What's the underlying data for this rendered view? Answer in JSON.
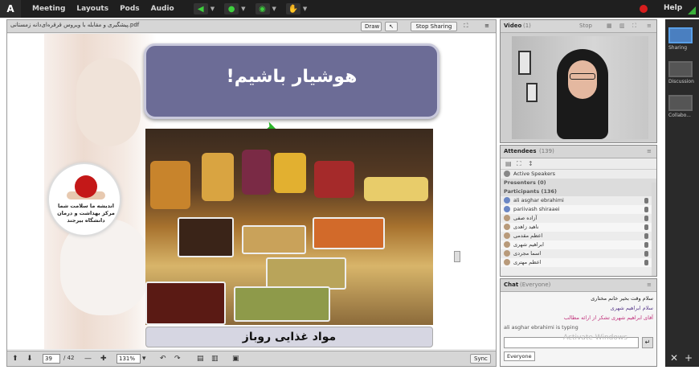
{
  "menubar": {
    "logo": "A",
    "items": [
      "Meeting",
      "Layouts",
      "Pods",
      "Audio"
    ],
    "help": "Help"
  },
  "share": {
    "filename": "پیشگیری و مقابله با ویروس قرقره‌ای‌دانه زمستانی.pdf",
    "draw_label": "Draw",
    "stop_label": "Stop Sharing",
    "menu_label": "≡"
  },
  "slide": {
    "title": "هوشیار باشیم!",
    "caption": "مواد غذایی روباز",
    "logo_text_1": "اندیشه ما سلامت شما",
    "logo_text_2": "مرکز بهداشت و درمان",
    "logo_text_3": "دانشگاه بیرجند"
  },
  "bottombar": {
    "page_value": "39",
    "page_total": "/ 42",
    "zoom_value": "131%",
    "sync_label": "Sync"
  },
  "video": {
    "title": "Video",
    "count": "(1)",
    "stop_label": "Stop"
  },
  "attendees": {
    "title": "Attendees",
    "count": "(139)",
    "active_speakers": "Active Speakers",
    "presenters": "Presenters (0)",
    "participants": "Participants (136)",
    "rows": [
      {
        "name": "ali asghar ebrahimi",
        "role": "host"
      },
      {
        "name": "pariivash shiraaei",
        "role": "host"
      },
      {
        "name": "آزاده صفی",
        "role": "participant"
      },
      {
        "name": "ناهید زاهدی",
        "role": "participant"
      },
      {
        "name": "اعظم مقدمی",
        "role": "participant"
      },
      {
        "name": "ابراهیم شهری",
        "role": "participant"
      },
      {
        "name": "اسما مجردی",
        "role": "participant"
      },
      {
        "name": "اعظم مهتری",
        "role": "participant"
      }
    ]
  },
  "chat": {
    "title": "Chat",
    "scope": "(Everyone)",
    "lines": [
      "سلام وقت بخیر خانم مختاری",
      "سلام ابراهیم شهری",
      "آقای ابراهیم شهری تشکر از ارائه مطالب",
      "ali asghar ebrahimi is typing"
    ],
    "tab": "Everyone",
    "watermark": "Activate Windows"
  },
  "layouts": {
    "items": [
      "Sharing",
      "Discussion",
      "Collabo..."
    ]
  },
  "colors": {
    "title_box": "#6c6c96",
    "caption_box": "#d6d6e2",
    "menubar": "#1f1f1f",
    "active_layout": "#4a7fc0"
  }
}
